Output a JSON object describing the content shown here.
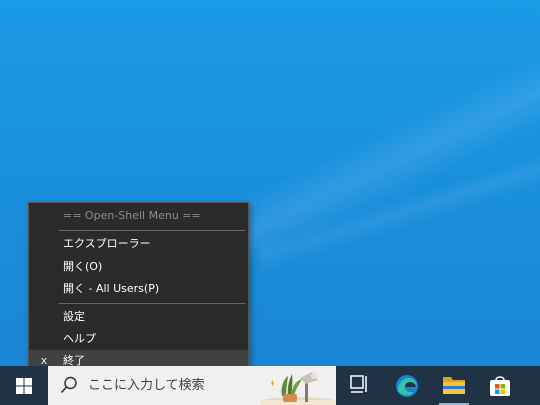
{
  "context_menu": {
    "header": "== Open-Shell Menu ==",
    "items": [
      {
        "label": "エクスプローラー"
      },
      {
        "label": "開く(O)"
      },
      {
        "label": "開く - All Users(P)"
      },
      {
        "label": "設定"
      },
      {
        "label": "ヘルプ"
      },
      {
        "label": "終了",
        "icon_text": "x"
      }
    ]
  },
  "taskbar": {
    "search_placeholder": "ここに入力して検索",
    "icons": [
      "windows-start-icon",
      "search-icon",
      "task-view-icon",
      "edge-icon",
      "file-explorer-icon",
      "microsoft-store-icon"
    ]
  },
  "colors": {
    "desktop": "#1a8fdc",
    "menu_bg": "#2b2b2b",
    "taskbar": "#1f3344",
    "search_bg": "#f0f0f0"
  }
}
